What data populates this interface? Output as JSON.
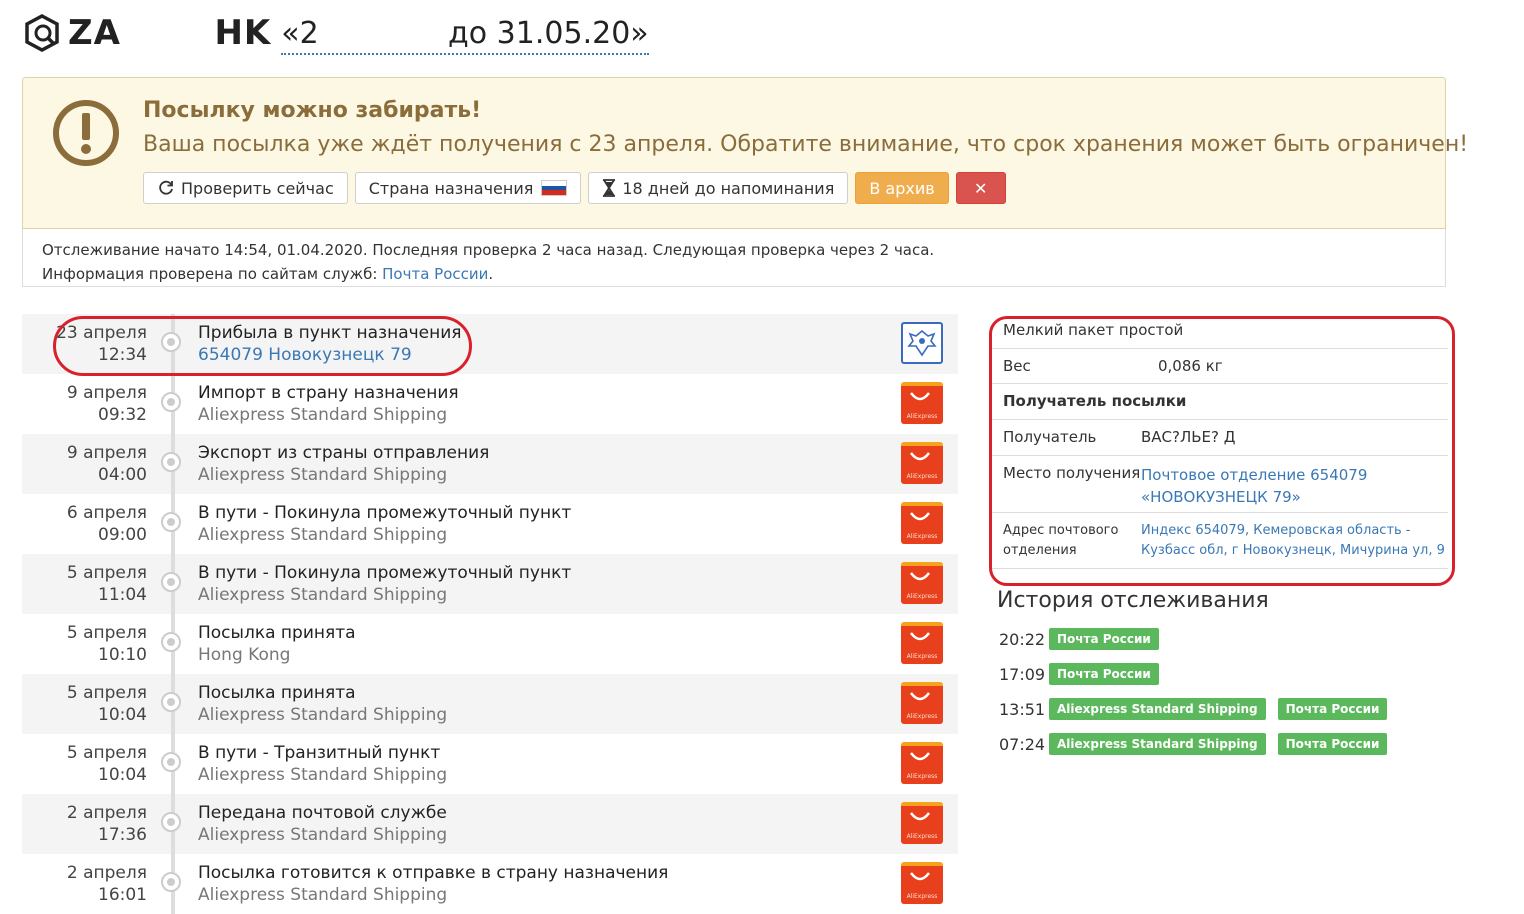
{
  "header": {
    "title_code": "ZA            HK",
    "title_rest": "«2                     до 31.05.20»"
  },
  "alert": {
    "title": "Посылку можно забирать!",
    "text": "Ваша посылка уже ждёт получения с 23 апреля. Обратите внимание, что срок хранения может быть ограничен!",
    "buttons": {
      "check": "Проверить сейчас",
      "country": "Страна назначения",
      "reminder": "18 дней до напоминания",
      "archive": "В архив",
      "close": "✕"
    }
  },
  "tracking_info": {
    "line1": "Отслеживание начато 14:54, 01.04.2020. Последняя проверка 2 часа назад. Следующая проверка через 2 часа.",
    "line2_prefix": "Информация проверена по сайтам служб: ",
    "line2_link": "Почта России",
    "line2_suffix": "."
  },
  "events": [
    {
      "date": "23 апреля",
      "time": "12:34",
      "title": "Прибыла в пункт назначения",
      "sub": "654079 Новокузнецк 79",
      "sub_link": true,
      "logo": "post"
    },
    {
      "date": "9 апреля",
      "time": "09:32",
      "title": "Импорт в страну назначения",
      "sub": "Aliexpress Standard Shipping",
      "sub_link": false,
      "logo": "ali"
    },
    {
      "date": "9 апреля",
      "time": "04:00",
      "title": "Экспорт из страны отправления",
      "sub": "Aliexpress Standard Shipping",
      "sub_link": false,
      "logo": "ali"
    },
    {
      "date": "6 апреля",
      "time": "09:00",
      "title": "В пути - Покинула промежуточный пункт",
      "sub": "Aliexpress Standard Shipping",
      "sub_link": false,
      "logo": "ali"
    },
    {
      "date": "5 апреля",
      "time": "11:04",
      "title": "В пути - Покинула промежуточный пункт",
      "sub": "Aliexpress Standard Shipping",
      "sub_link": false,
      "logo": "ali"
    },
    {
      "date": "5 апреля",
      "time": "10:10",
      "title": "Посылка принята",
      "sub": "Hong Kong",
      "sub_link": false,
      "logo": "ali"
    },
    {
      "date": "5 апреля",
      "time": "10:04",
      "title": "Посылка принята",
      "sub": "Aliexpress Standard Shipping",
      "sub_link": false,
      "logo": "ali"
    },
    {
      "date": "5 апреля",
      "time": "10:04",
      "title": "В пути - Транзитный пункт",
      "sub": "Aliexpress Standard Shipping",
      "sub_link": false,
      "logo": "ali"
    },
    {
      "date": "2 апреля",
      "time": "17:36",
      "title": "Передана почтовой службе",
      "sub": "Aliexpress Standard Shipping",
      "sub_link": false,
      "logo": "ali"
    },
    {
      "date": "2 апреля",
      "time": "16:01",
      "title": "Посылка готовится к отправке в страну назначения",
      "sub": "Aliexpress Standard Shipping",
      "sub_link": false,
      "logo": "ali"
    }
  ],
  "aliexpress_logo_text": "AliExpress",
  "panel": {
    "type": "Мелкий пакет простой",
    "weight_label": "Вес",
    "weight_value": "0,086 кг",
    "recipient_header": "Получатель посылки",
    "recipient_label": "Получатель",
    "recipient_value": "ВАС?ЛЬЕ? Д",
    "place_label": "Место получения",
    "place_value_1": "Почтовое отделение 654079",
    "place_value_2": "«НОВОКУЗНЕЦК 79»",
    "address_label_1": "Адрес почтового",
    "address_label_2": "отделения",
    "address_value_1": "Индекс 654079, Кемеровская область -",
    "address_value_2": "Кузбасс обл, г Новокузнецк, Мичурина ул, 9"
  },
  "history": {
    "title": "История отслеживания",
    "rows": [
      {
        "time": "20:22",
        "badges": [
          "Почта России"
        ]
      },
      {
        "time": "17:09",
        "badges": [
          "Почта России"
        ]
      },
      {
        "time": "13:51",
        "badges": [
          "Aliexpress Standard Shipping",
          "Почта России"
        ]
      },
      {
        "time": "07:24",
        "badges": [
          "Aliexpress Standard Shipping",
          "Почта России"
        ]
      }
    ]
  },
  "colors": {
    "alert_bg": "#fcf8e3",
    "alert_text": "#8a6d3b",
    "link": "#3a78b5",
    "archive_btn": "#f0ad4e",
    "close_btn": "#d9534f",
    "badge": "#5cb85c",
    "highlight_oval": "#d8212a"
  }
}
